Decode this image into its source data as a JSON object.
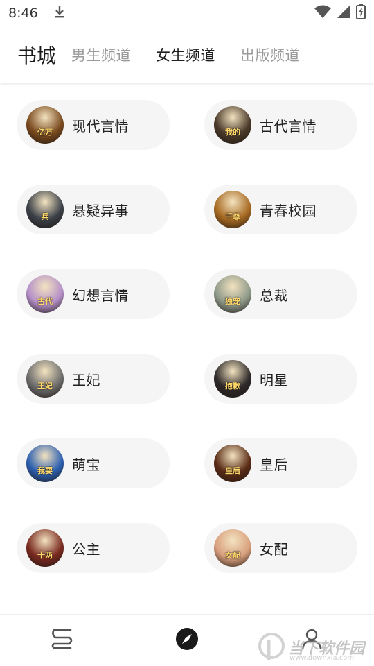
{
  "status_bar": {
    "time": "8:46",
    "icons": [
      "download-icon",
      "wifi-icon",
      "signal-icon",
      "battery-charging-icon"
    ]
  },
  "header": {
    "title": "书城",
    "tabs": [
      {
        "label": "男生频道",
        "active": false
      },
      {
        "label": "女生频道",
        "active": true
      },
      {
        "label": "出版频道",
        "active": false
      }
    ]
  },
  "categories": [
    {
      "label": "现代言情",
      "cover_color": "#7a4a1e",
      "cover_text": "亿万"
    },
    {
      "label": "古代言情",
      "cover_color": "#4a3a2a",
      "cover_text": "我的"
    },
    {
      "label": "悬疑异事",
      "cover_color": "#3b4048",
      "cover_text": "兵"
    },
    {
      "label": "青春校园",
      "cover_color": "#a86a22",
      "cover_text": "千尊"
    },
    {
      "label": "幻想言情",
      "cover_color": "#b590c9",
      "cover_text": "古代"
    },
    {
      "label": "总裁",
      "cover_color": "#8f9a8a",
      "cover_text": "独宠"
    },
    {
      "label": "王妃",
      "cover_color": "#6e6e6e",
      "cover_text": "王妃"
    },
    {
      "label": "明星",
      "cover_color": "#2e2a2a",
      "cover_text": "抱歉"
    },
    {
      "label": "萌宝",
      "cover_color": "#2c5fb0",
      "cover_text": "我要"
    },
    {
      "label": "皇后",
      "cover_color": "#5a2c16",
      "cover_text": "皇后"
    },
    {
      "label": "公主",
      "cover_color": "#7a2a20",
      "cover_text": "十两"
    },
    {
      "label": "女配",
      "cover_color": "#d9a07e",
      "cover_text": "女配"
    }
  ],
  "bottom_nav": {
    "items": [
      "bookshelf-icon",
      "discover-compass-icon",
      "profile-icon"
    ]
  },
  "watermark": {
    "text": "当下软件园",
    "url": "www.downxia.com"
  }
}
